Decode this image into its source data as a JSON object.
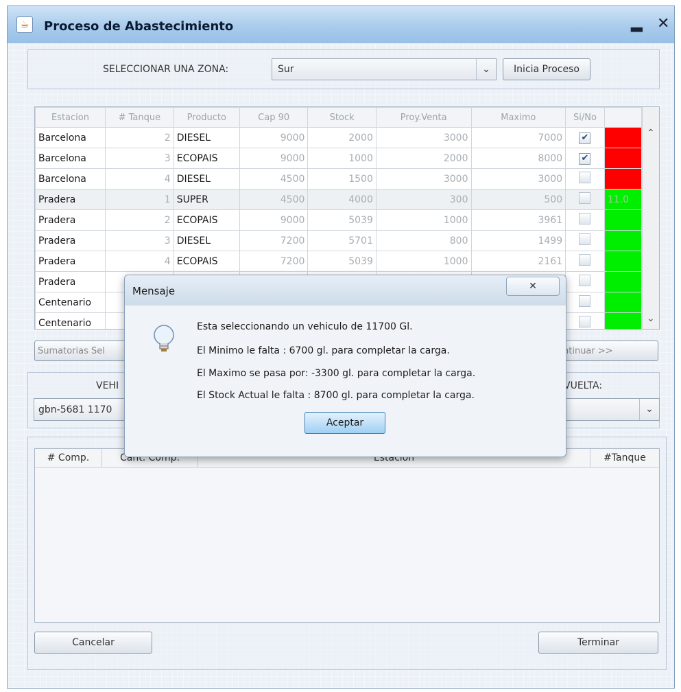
{
  "window": {
    "title": "Proceso de Abastecimiento",
    "icon": "java-cup-icon",
    "minimize_glyph": "▂",
    "close_glyph": "✕"
  },
  "zone": {
    "label": "SELECCIONAR UNA ZONA:",
    "selected": "Sur",
    "start_button": "Inicia Proceso"
  },
  "table": {
    "columns": [
      "Estacion",
      "# Tanque",
      "Producto",
      "Cap 90",
      "Stock",
      "Proy.Venta",
      "Maximo",
      "Si/No",
      ""
    ],
    "rows": [
      {
        "estacion": "Barcelona",
        "tanque": "2",
        "producto": "DIESEL",
        "cap": "9000",
        "stock": "2000",
        "proy": "3000",
        "maximo": "7000",
        "si": true,
        "status": "red",
        "status_text": ""
      },
      {
        "estacion": "Barcelona",
        "tanque": "3",
        "producto": "ECOPAIS",
        "cap": "9000",
        "stock": "1000",
        "proy": "2000",
        "maximo": "8000",
        "si": true,
        "status": "red",
        "status_text": ""
      },
      {
        "estacion": "Barcelona",
        "tanque": "4",
        "producto": "DIESEL",
        "cap": "4500",
        "stock": "1500",
        "proy": "3000",
        "maximo": "3000",
        "si": false,
        "status": "red",
        "status_text": ""
      },
      {
        "estacion": "Pradera",
        "tanque": "1",
        "producto": "SUPER",
        "cap": "4500",
        "stock": "4000",
        "proy": "300",
        "maximo": "500",
        "si": false,
        "status": "green",
        "status_text": "11.0"
      },
      {
        "estacion": "Pradera",
        "tanque": "2",
        "producto": "ECOPAIS",
        "cap": "9000",
        "stock": "5039",
        "proy": "1000",
        "maximo": "3961",
        "si": false,
        "status": "green",
        "status_text": ""
      },
      {
        "estacion": "Pradera",
        "tanque": "3",
        "producto": "DIESEL",
        "cap": "7200",
        "stock": "5701",
        "proy": "800",
        "maximo": "1499",
        "si": false,
        "status": "green",
        "status_text": ""
      },
      {
        "estacion": "Pradera",
        "tanque": "4",
        "producto": "ECOPAIS",
        "cap": "7200",
        "stock": "5039",
        "proy": "1000",
        "maximo": "2161",
        "si": false,
        "status": "green",
        "status_text": ""
      },
      {
        "estacion": "Pradera",
        "tanque": "",
        "producto": "",
        "cap": "",
        "stock": "",
        "proy": "",
        "maximo": "",
        "si": false,
        "status": "green",
        "status_text": ""
      },
      {
        "estacion": "Centenario",
        "tanque": "",
        "producto": "",
        "cap": "",
        "stock": "",
        "proy": "",
        "maximo": "",
        "si": false,
        "status": "green",
        "status_text": ""
      },
      {
        "estacion": "Centenario",
        "tanque": "",
        "producto": "",
        "cap": "",
        "stock": "",
        "proy": "",
        "maximo": "",
        "si": false,
        "status": "green",
        "status_text": ""
      }
    ]
  },
  "sums_button": "Sumatorias Sel",
  "continue_button": "ntinuar >>",
  "vehicle": {
    "label_partial": "VEHI",
    "value_partial": "gbn-5681 1170",
    "vuelta_label": "VUELTA:"
  },
  "bottom_table": {
    "columns": [
      "# Comp.",
      "Cant. Comp.",
      "Estacion",
      "#Tanque"
    ]
  },
  "buttons": {
    "cancel": "Cancelar",
    "finish": "Terminar"
  },
  "dialog": {
    "title": "Mensaje",
    "close_glyph": "✕",
    "lines": [
      "Esta seleccionando un vehiculo de 11700 Gl.",
      "El Minimo le falta : 6700 gl.  para completar la carga.",
      "El Maximo  se pasa por: -3300 gl.  para completar la carga.",
      "El Stock Actual  le falta : 8700 gl.  para completar la carga."
    ],
    "ok": "Aceptar",
    "icon": "lightbulb-icon"
  },
  "colors": {
    "red": "#ff0000",
    "green": "#00ee00",
    "accent": "#9cc3ea"
  }
}
